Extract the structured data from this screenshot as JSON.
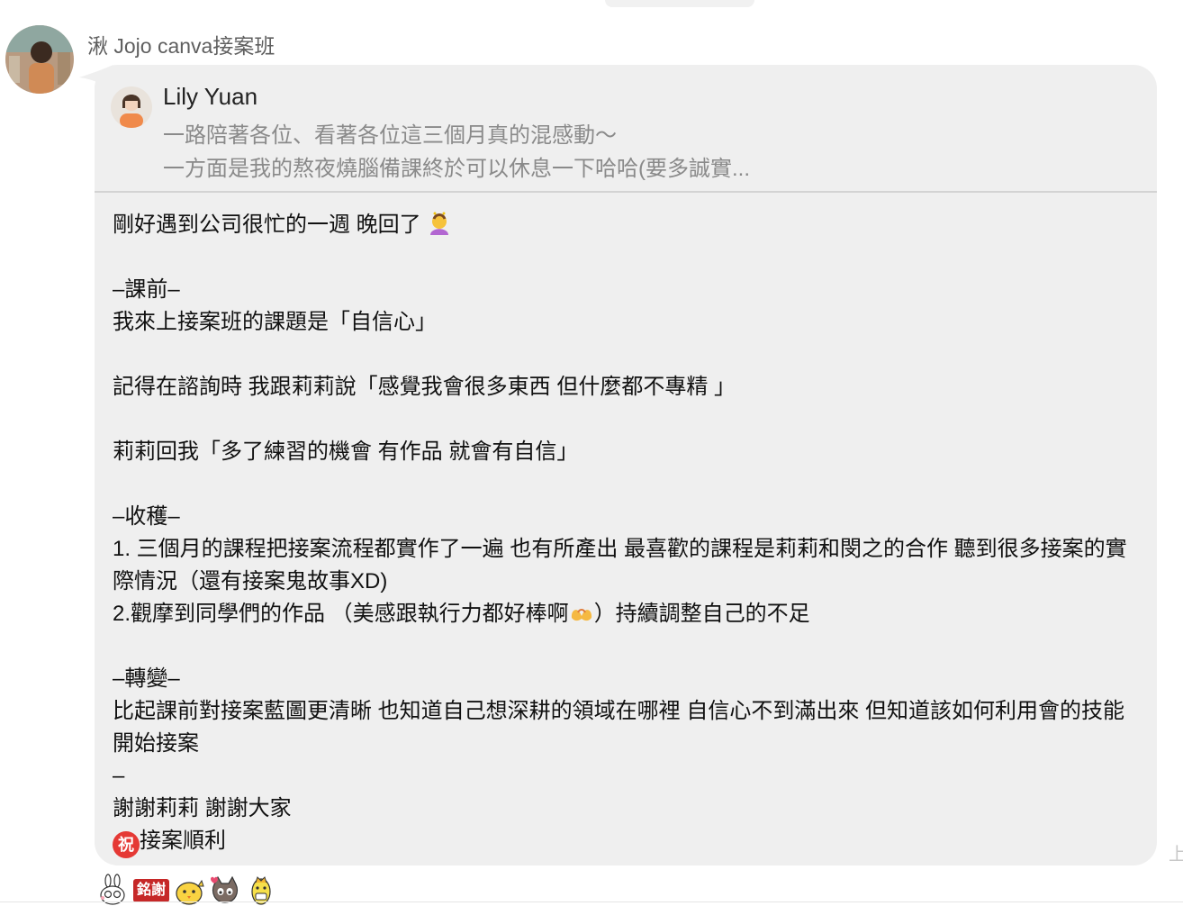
{
  "sender": {
    "name": "湫 Jojo canva接案班"
  },
  "quoted": {
    "name": "Lily Yuan",
    "line1": "一路陪著各位、看著各位這三個月真的混感動～",
    "line2": "一方面是我的熬夜燒腦備課終於可以休息一下哈哈(要多誠實..."
  },
  "message": {
    "l1": "剛好遇到公司很忙的一週 晚回了",
    "l2": "–課前–",
    "l3": "我來上接案班的課題是「自信心」",
    "l4": "記得在諮詢時 我跟莉莉說「感覺我會很多東西 但什麼都不專精 」",
    "l5": "莉莉回我「多了練習的機會 有作品 就會有自信」",
    "l6": "–收穫–",
    "l7": "1. 三個月的課程把接案流程都實作了一遍 也有所產出 最喜歡的課程是莉莉和閔之的合作 聽到很多接案的實際情況（還有接案鬼故事XD)",
    "l8a": "2.觀摩到同學們的作品 （美感跟執行力都好棒啊",
    "l8b": "）持續調整自己的不足",
    "l9": "–轉變–",
    "l10": "比起課前對接案藍圖更清晰 也知道自己想深耕的領域在哪裡 自信心不到滿出來 但知道該如何利用會的技能 開始接案",
    "l11": "–",
    "l12": "謝謝莉莉 謝謝大家",
    "zhu": "祝",
    "l13": "接案順利"
  },
  "reactions": {
    "sticker2_text": "銘謝"
  },
  "side_mark": "上",
  "colors": {
    "bubble": "#efefef",
    "quote_text": "#8a8a8a",
    "sender_name": "#5f5f5f",
    "zhu_badge": "#e53935"
  }
}
